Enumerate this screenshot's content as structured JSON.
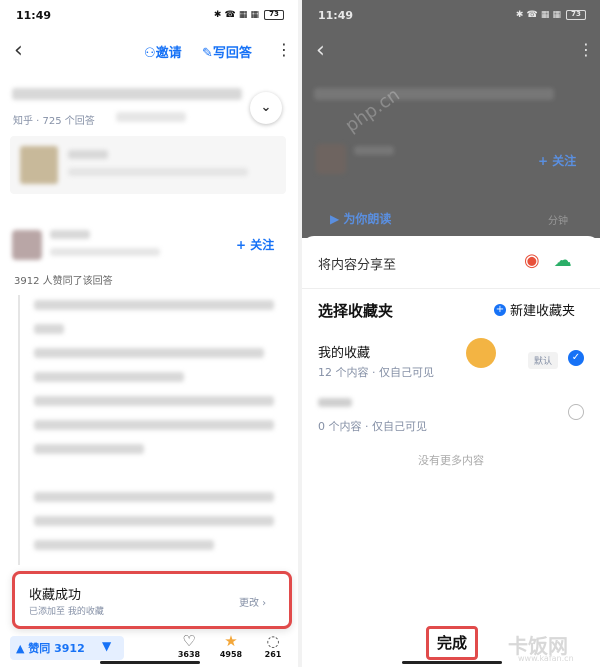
{
  "status_bar": {
    "time": "11:49",
    "indicators": "✱ ☎ ▦ ▦",
    "battery": "73"
  },
  "left": {
    "header": {
      "invite_label": "邀请",
      "write_answer_label": "写回答"
    },
    "question_meta": "知乎 · 725 个回答",
    "endorse_text": "3912 人赞同了该回答",
    "follow_label": "+ 关注",
    "toast": {
      "title": "收藏成功",
      "subtitle": "已添加至 我的收藏",
      "action": "更改 ›"
    },
    "bottom_bar": {
      "vote_label": "▲ 赞同 3912",
      "comments_count": "3638",
      "favorites_count": "4958",
      "replies_count": "261"
    }
  },
  "right": {
    "overlay": {
      "time": "11:49",
      "follow_label": "+ 关注",
      "read_label": "为你朗读",
      "duration": "分钟"
    },
    "sheet": {
      "share_label": "将内容分享至",
      "title": "选择收藏夹",
      "new_folder_label": "新建收藏夹",
      "folders": [
        {
          "name": "我的收藏",
          "meta": "12 个内容 · 仅自己可见",
          "badge": "默认",
          "selected": true
        },
        {
          "name": "",
          "meta": "0 个内容 · 仅自己可见",
          "selected": false
        }
      ],
      "no_more": "没有更多内容",
      "done_label": "完成"
    },
    "watermark": "卡饭网",
    "watermark_url": "www.kafan.cn",
    "watermark_side": "php.cn"
  },
  "colors": {
    "accent": "#1772f6",
    "highlight": "#e14b4b",
    "orange": "#f3b443"
  }
}
